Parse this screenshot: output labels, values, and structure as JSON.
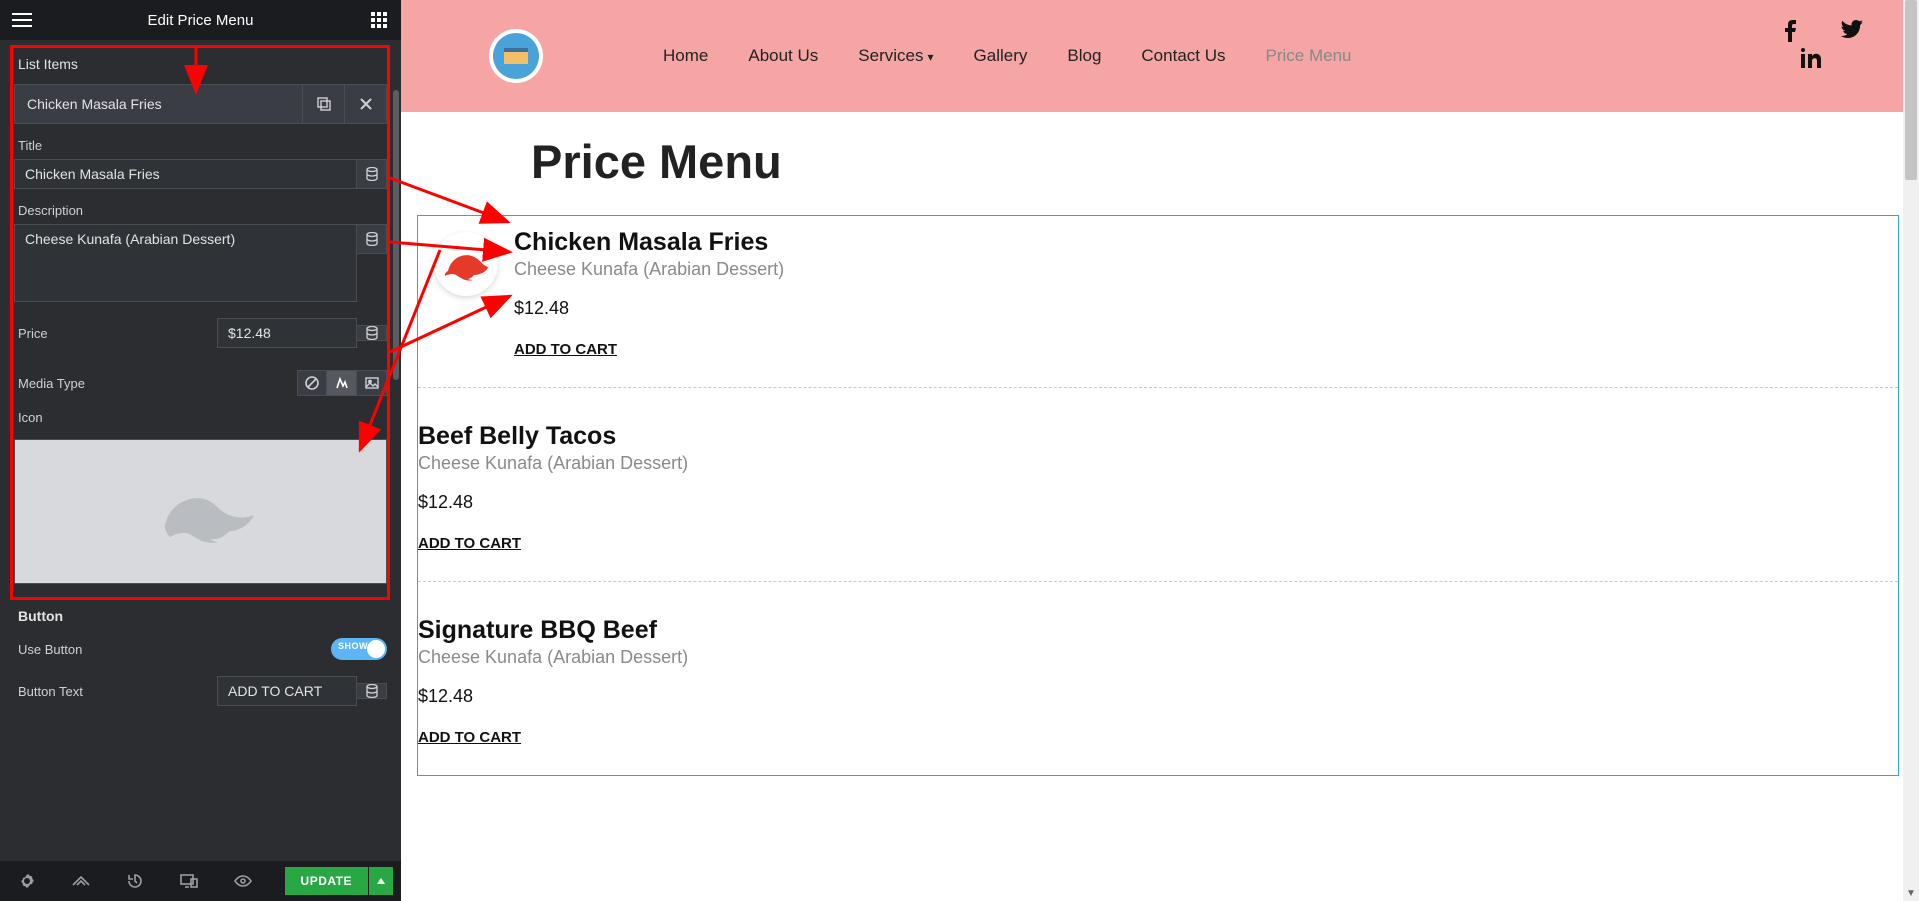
{
  "editor": {
    "header_title": "Edit Price Menu",
    "list_items_label": "List Items",
    "item_header_name": "Chicken Masala Fries",
    "title_label": "Title",
    "title_value": "Chicken Masala Fries",
    "description_label": "Description",
    "description_value": "Cheese Kunafa (Arabian Dessert)",
    "price_label": "Price",
    "price_value": "$12.48",
    "media_type_label": "Media Type",
    "icon_label": "Icon",
    "button_section_label": "Button",
    "use_button_label": "Use Button",
    "use_button_state": "SHOW",
    "button_text_label": "Button Text",
    "button_text_value": "ADD TO CART",
    "update_label": "UPDATE"
  },
  "nav": {
    "items": [
      {
        "label": "Home"
      },
      {
        "label": "About Us"
      },
      {
        "label": "Services",
        "dropdown": true
      },
      {
        "label": "Gallery"
      },
      {
        "label": "Blog"
      },
      {
        "label": "Contact Us"
      },
      {
        "label": "Price Menu",
        "active": true
      }
    ]
  },
  "page": {
    "title": "Price Menu"
  },
  "menu": [
    {
      "title": "Chicken Masala Fries",
      "desc": "Cheese Kunafa (Arabian Dessert)",
      "price": "$12.48",
      "cart": "ADD TO CART",
      "icon": true
    },
    {
      "title": "Beef Belly Tacos",
      "desc": "Cheese Kunafa (Arabian Dessert)",
      "price": "$12.48",
      "cart": "ADD TO CART",
      "icon": false
    },
    {
      "title": "Signature BBQ Beef",
      "desc": "Cheese Kunafa (Arabian Dessert)",
      "price": "$12.48",
      "cart": "ADD TO CART",
      "icon": false
    }
  ]
}
